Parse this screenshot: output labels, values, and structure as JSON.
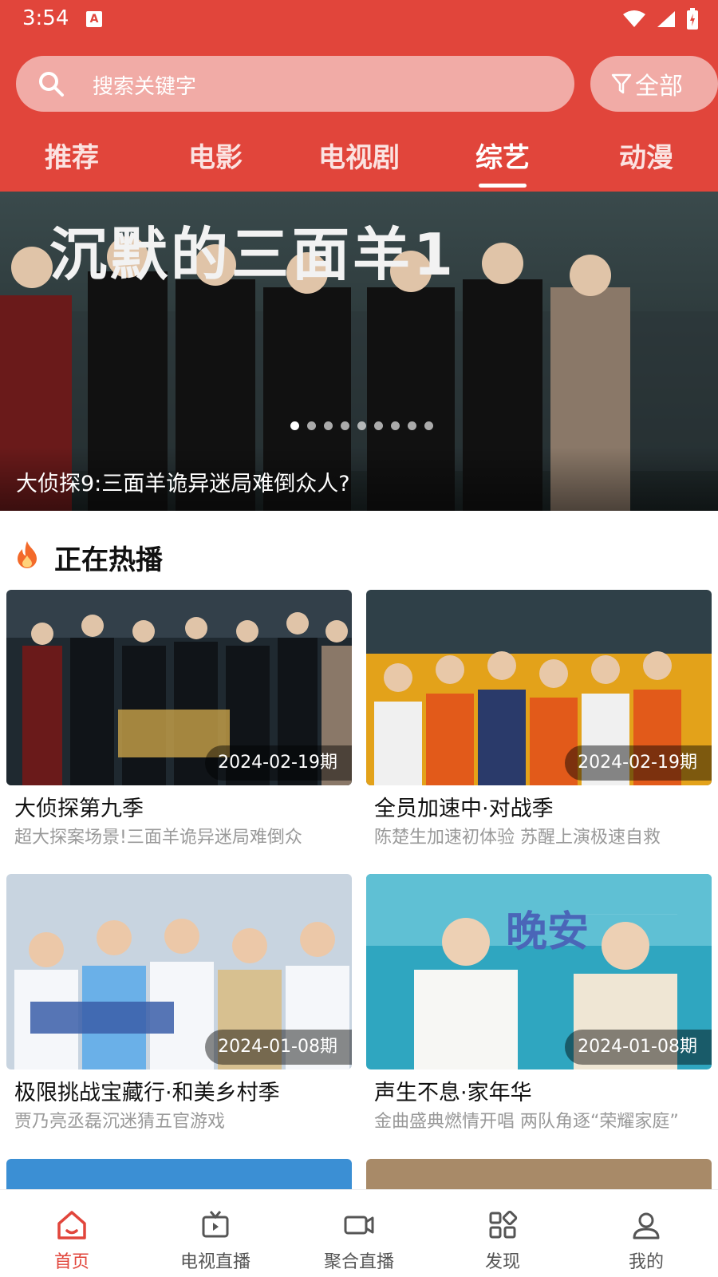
{
  "status_bar": {
    "time": "3:54",
    "notification_icon": "A"
  },
  "search": {
    "placeholder": "搜索关键字",
    "filter_label": "全部"
  },
  "tabs": [
    {
      "label": "推荐",
      "active": false
    },
    {
      "label": "电影",
      "active": false
    },
    {
      "label": "电视剧",
      "active": false
    },
    {
      "label": "综艺",
      "active": true
    },
    {
      "label": "动漫",
      "active": false
    }
  ],
  "banner": {
    "caption": "大侦探9:三面羊诡异迷局难倒众人?",
    "headline_text": "沉默的三面羊1",
    "dot_count": 9,
    "active_dot": 0
  },
  "section": {
    "title": "正在热播",
    "icon": "fire-icon"
  },
  "cards": [
    {
      "date": "2024-02-19期",
      "title": "大侦探第九季",
      "subtitle": "超大探案场景!三面羊诡异迷局难倒众"
    },
    {
      "date": "2024-02-19期",
      "title": "全员加速中·对战季",
      "subtitle": "陈楚生加速初体验 苏醒上演极速自救"
    },
    {
      "date": "2024-01-08期",
      "title": "极限挑战宝藏行·和美乡村季",
      "subtitle": "贾乃亮丞磊沉迷猜五官游戏"
    },
    {
      "date": "2024-01-08期",
      "title": "声生不息·家年华",
      "subtitle": "金曲盛典燃情开唱 两队角逐“荣耀家庭”"
    }
  ],
  "bottom_nav": [
    {
      "label": "首页",
      "icon": "home-icon",
      "active": true
    },
    {
      "label": "电视直播",
      "icon": "tv-icon",
      "active": false
    },
    {
      "label": "聚合直播",
      "icon": "video-camera-icon",
      "active": false
    },
    {
      "label": "发现",
      "icon": "grid-icon",
      "active": false
    },
    {
      "label": "我的",
      "icon": "user-icon",
      "active": false
    }
  ],
  "colors": {
    "accent": "#e1453b",
    "muted_text": "#999999"
  }
}
